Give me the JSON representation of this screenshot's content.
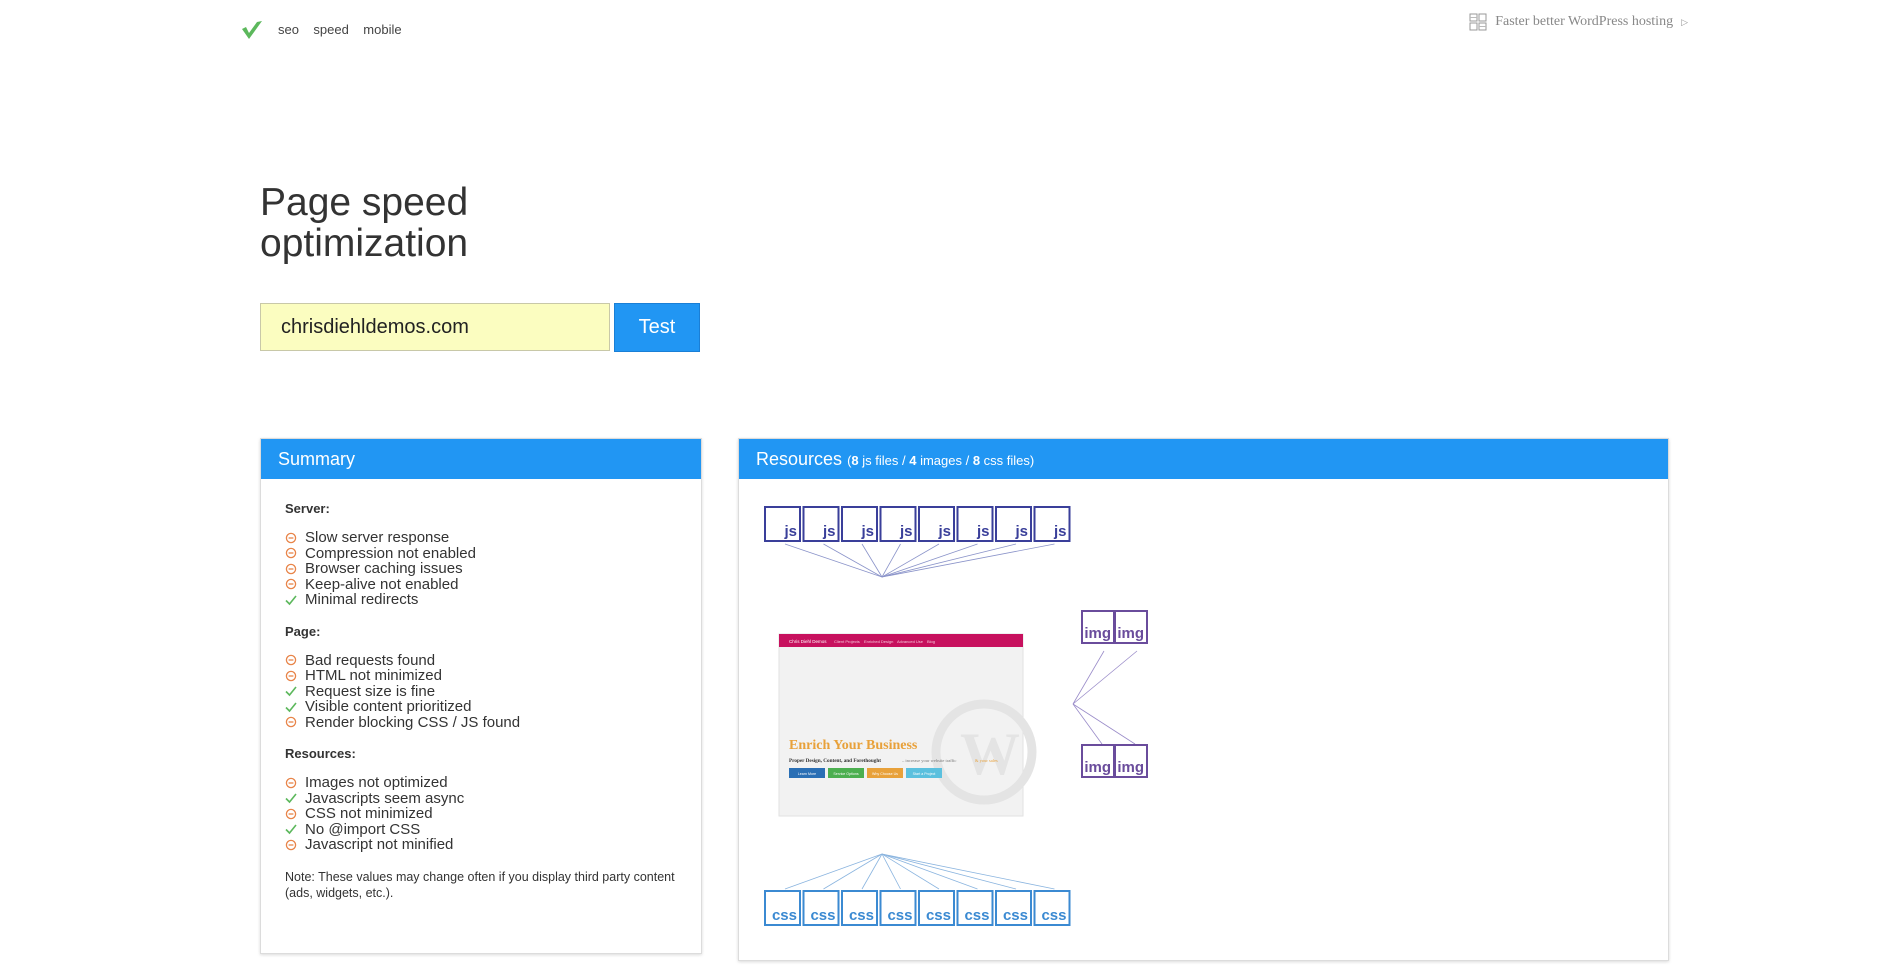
{
  "nav": {
    "links": [
      "seo",
      "speed",
      "mobile"
    ],
    "promo_label": "Faster better WordPress hosting"
  },
  "page": {
    "title": "Page speed optimization"
  },
  "form": {
    "url_value": "chrisdiehldemos.com",
    "button_label": "Test"
  },
  "summary": {
    "title": "Summary",
    "sections": [
      {
        "title": "Server:",
        "items": [
          {
            "label": "Slow server response",
            "status": "warn"
          },
          {
            "label": "Compression not enabled",
            "status": "warn"
          },
          {
            "label": "Browser caching issues",
            "status": "warn"
          },
          {
            "label": "Keep-alive not enabled",
            "status": "warn"
          },
          {
            "label": "Minimal redirects",
            "status": "ok"
          }
        ]
      },
      {
        "title": "Page:",
        "items": [
          {
            "label": "Bad requests found",
            "status": "warn"
          },
          {
            "label": "HTML not minimized",
            "status": "warn"
          },
          {
            "label": "Request size is fine",
            "status": "ok"
          },
          {
            "label": "Visible content prioritized",
            "status": "ok"
          },
          {
            "label": "Render blocking CSS / JS found",
            "status": "warn"
          }
        ]
      },
      {
        "title": "Resources:",
        "items": [
          {
            "label": "Images not optimized",
            "status": "warn"
          },
          {
            "label": "Javascripts seem async",
            "status": "ok"
          },
          {
            "label": "CSS not minimized",
            "status": "warn"
          },
          {
            "label": "No @import CSS",
            "status": "ok"
          },
          {
            "label": "Javascript not minified",
            "status": "warn"
          }
        ]
      }
    ],
    "note": "Note: These values may change often if you display third party content (ads, widgets, etc.)."
  },
  "resources": {
    "title": "Resources",
    "js_count": "8",
    "img_count": "4",
    "css_count": "8",
    "js_label": "js",
    "img_label": "img",
    "css_label": "css",
    "js_files_text": " js files / ",
    "images_text": " images / ",
    "css_files_text": " css files)",
    "open_paren": "(",
    "preview": {
      "site_name": "Chris Diehl Demos",
      "menu": [
        "Client Projects",
        "Enriched Design",
        "Advanced Use",
        "Blog"
      ],
      "headline": "Enrich Your Business",
      "tagline": "Proper Design, Content, and Forethought",
      "tagline_tail": "– increase your website traffic",
      "tagline_accent": "& your sales",
      "buttons": [
        "Learn More",
        "Service Options",
        "Why Choose Us",
        "Start a Project"
      ]
    }
  },
  "colors": {
    "accent": "#2196f3",
    "warn": "#e8854a",
    "ok": "#5cb85c",
    "js_box": "#3a3f9a",
    "img_box": "#6a4c9c",
    "css_box": "#3b8ad2",
    "logo_green": "#5cb85c",
    "preview_bar": "#c7115e",
    "preview_headline": "#e8a13a"
  }
}
